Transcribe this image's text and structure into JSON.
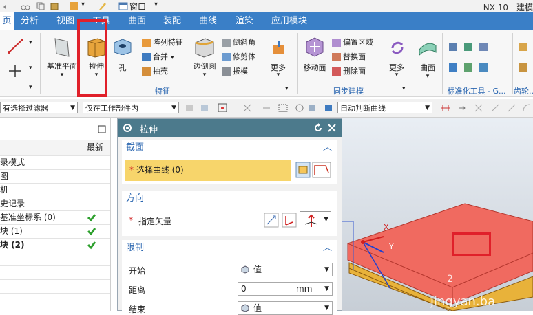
{
  "app": {
    "title": "NX 10 - 建模",
    "window_menu": "窗口"
  },
  "tabs": [
    {
      "label": "页",
      "active": true
    },
    {
      "label": "分析",
      "active": false
    },
    {
      "label": "视图",
      "active": false
    },
    {
      "label": "工具",
      "active": false
    },
    {
      "label": "曲面",
      "active": false
    },
    {
      "label": "装配",
      "active": false
    },
    {
      "label": "曲线",
      "active": false
    },
    {
      "label": "渲染",
      "active": false
    },
    {
      "label": "应用模块",
      "active": false
    }
  ],
  "ribbon": {
    "datum_plane": "基准平面",
    "extrude": "拉伸",
    "hole": "孔",
    "pattern_feature": "阵列特征",
    "unite": "合并",
    "shell": "抽壳",
    "edge_blend": "边倒圆",
    "chamfer": "倒斜角",
    "trim_body": "修剪体",
    "draft": "拔模",
    "more1": "更多",
    "move_face": "移动面",
    "offset_region": "偏置区域",
    "replace_face": "替换面",
    "delete_face": "删除面",
    "more2": "更多",
    "surface": "曲面",
    "group_feature": "特征",
    "group_sync": "同步建模",
    "group_std": "标准化工具 - G...",
    "group_gear": "齿轮..."
  },
  "filterbar": {
    "selection_filter": "有选择过滤器",
    "scope": "仅在工作部件内",
    "curve_rule": "自动判断曲线"
  },
  "navigator": {
    "latest_header": "最新",
    "rows": [
      {
        "label": "录模式",
        "check": false
      },
      {
        "label": "图",
        "check": false
      },
      {
        "label": "机",
        "check": false
      },
      {
        "label": "史记录",
        "check": false
      },
      {
        "label": "基准坐标系 (0)",
        "check": true
      },
      {
        "label": "块 (1)",
        "check": true
      },
      {
        "label": "块 (2)",
        "check": true
      }
    ]
  },
  "dialog": {
    "title": "拉伸",
    "section_header": "截面",
    "select_curve": "选择曲线 (0)",
    "direction_header": "方向",
    "specify_vector": "指定矢量",
    "limits_header": "限制",
    "start_label": "开始",
    "start_value": "值",
    "distance_label": "距离",
    "distance_value": "0",
    "distance_unit": "mm",
    "end_label": "结束",
    "end_value": "值"
  },
  "viewport": {
    "axis_x": "X",
    "axis_y": "Y",
    "watermark": "jingyan.ba",
    "tag": "2"
  },
  "colors": {
    "highlight_box": "#e0202a",
    "tab_bar": "#3a7fc7",
    "dialog_head": "#4c7a8c",
    "plate": "#f06a60"
  }
}
